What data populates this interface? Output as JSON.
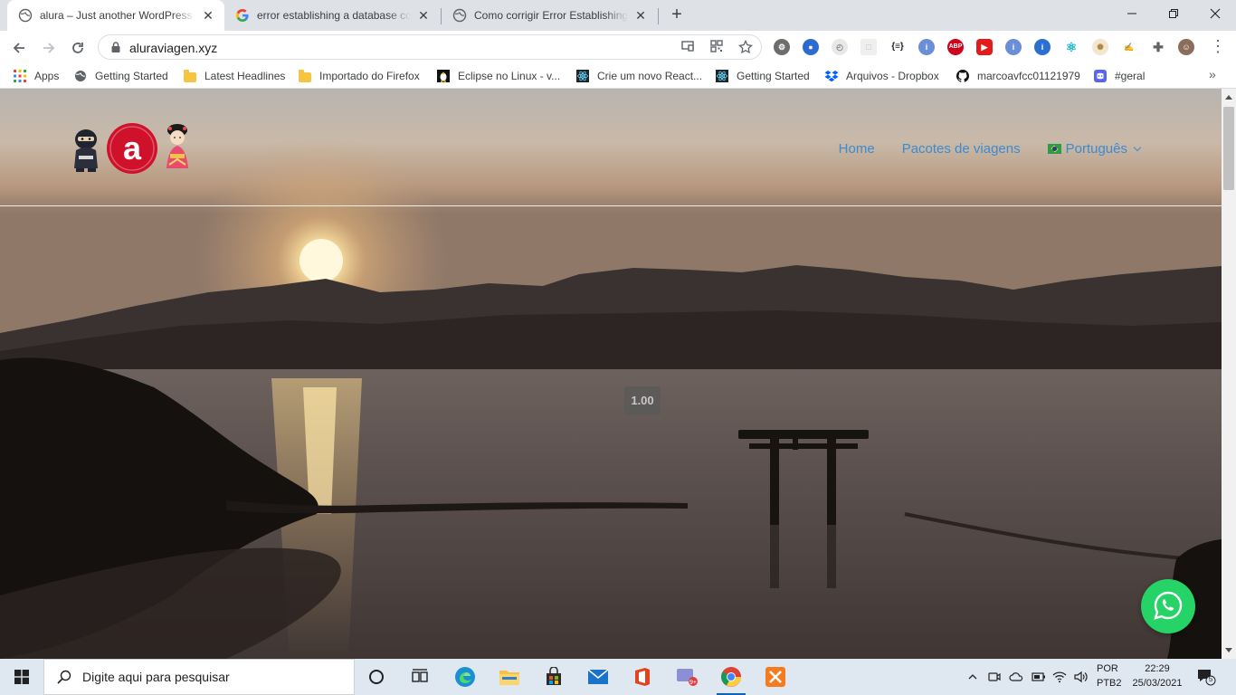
{
  "browser": {
    "tabs": [
      {
        "title": "alura – Just another WordPress site",
        "active": true
      },
      {
        "title": "error establishing a database connection",
        "active": false
      },
      {
        "title": "Como corrigir Error Establishing a Database",
        "active": false
      }
    ],
    "address": "aluraviagen.xyz",
    "bookmarks": [
      {
        "label": "Apps",
        "icon": "apps-grid-icon"
      },
      {
        "label": "Getting Started",
        "icon": "globe-icon"
      },
      {
        "label": "Latest Headlines",
        "icon": "folder-icon"
      },
      {
        "label": "Importado do Firefox",
        "icon": "folder-icon"
      },
      {
        "label": "Eclipse no Linux - v...",
        "icon": "tux-icon"
      },
      {
        "label": "Crie um novo React...",
        "icon": "react-icon"
      },
      {
        "label": "Getting Started",
        "icon": "react-icon"
      },
      {
        "label": "Arquivos - Dropbox",
        "icon": "dropbox-icon"
      },
      {
        "label": "marcoavfcc01121979",
        "icon": "github-icon"
      },
      {
        "label": "#geral",
        "icon": "discord-icon"
      }
    ]
  },
  "site": {
    "nav": [
      {
        "label": "Home"
      },
      {
        "label": "Pacotes de viagens"
      },
      {
        "label": "Português"
      }
    ],
    "video_speed": "1.00",
    "colors": {
      "nav_link": "#3b8bd4",
      "whatsapp": "#25d366",
      "logo_red": "#d0112b"
    }
  },
  "taskbar": {
    "search_placeholder": "Digite aqui para pesquisar",
    "lang_line1": "POR",
    "lang_line2": "PTB2",
    "time": "22:29",
    "date": "25/03/2021",
    "notification_count": "5"
  }
}
